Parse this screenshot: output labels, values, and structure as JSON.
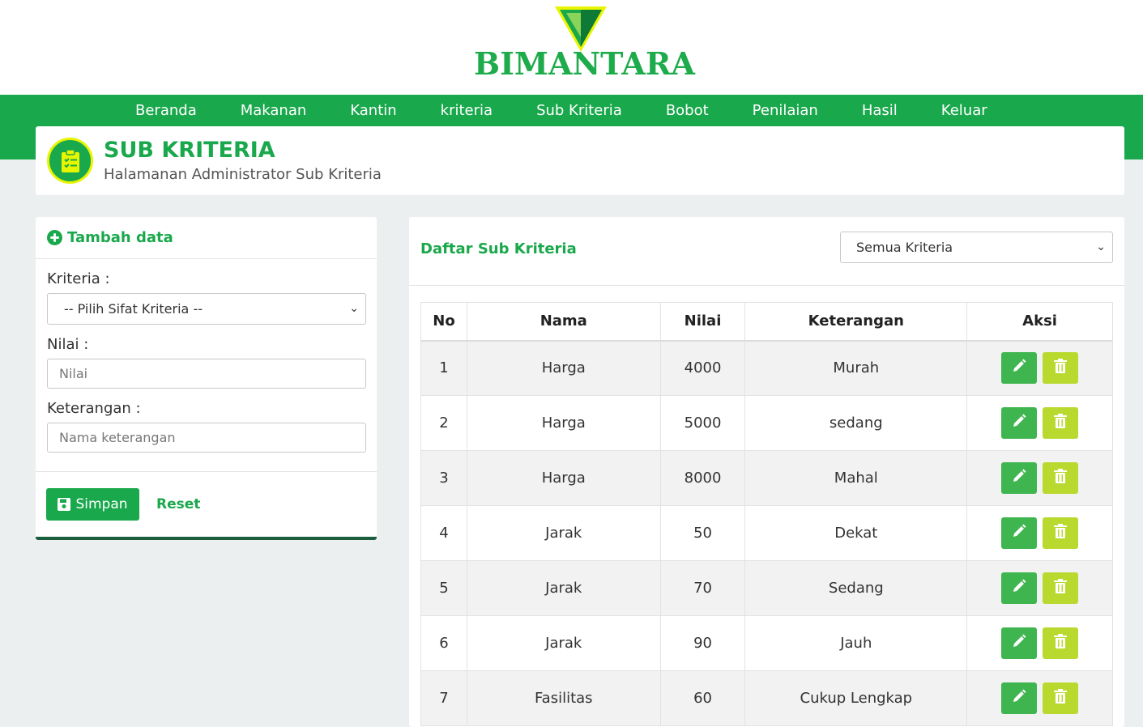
{
  "brand": {
    "name": "BIMANTARA",
    "colors": {
      "primary": "#1aa84c",
      "accent": "#e8f500",
      "delete": "#b9d92f",
      "edit": "#3fb54f"
    }
  },
  "nav": {
    "items": [
      {
        "label": "Beranda"
      },
      {
        "label": "Makanan"
      },
      {
        "label": "Kantin"
      },
      {
        "label": "kriteria"
      },
      {
        "label": "Sub Kriteria"
      },
      {
        "label": "Bobot"
      },
      {
        "label": "Penilaian"
      },
      {
        "label": "Hasil"
      },
      {
        "label": "Keluar"
      }
    ]
  },
  "page": {
    "icon": "clipboard-icon",
    "title": "SUB KRITERIA",
    "subtitle": "Halamanan Administrator Sub Kriteria"
  },
  "form": {
    "title": "Tambah data",
    "title_icon": "plus-circle-icon",
    "kriteria_label": "Kriteria :",
    "kriteria_selected": "-- Pilih Sifat Kriteria --",
    "nilai_label": "Nilai :",
    "nilai_placeholder": "Nilai",
    "keterangan_label": "Keterangan :",
    "keterangan_placeholder": "Nama keterangan",
    "save_label": "Simpan",
    "save_icon": "floppy-icon",
    "reset_label": "Reset"
  },
  "list": {
    "title": "Daftar Sub Kriteria",
    "filter_selected": "Semua Kriteria",
    "columns": [
      "No",
      "Nama",
      "Nilai",
      "Keterangan",
      "Aksi"
    ],
    "rows": [
      {
        "no": "1",
        "nama": "Harga",
        "nilai": "4000",
        "keterangan": "Murah"
      },
      {
        "no": "2",
        "nama": "Harga",
        "nilai": "5000",
        "keterangan": "sedang"
      },
      {
        "no": "3",
        "nama": "Harga",
        "nilai": "8000",
        "keterangan": "Mahal"
      },
      {
        "no": "4",
        "nama": "Jarak",
        "nilai": "50",
        "keterangan": "Dekat"
      },
      {
        "no": "5",
        "nama": "Jarak",
        "nilai": "70",
        "keterangan": "Sedang"
      },
      {
        "no": "6",
        "nama": "Jarak",
        "nilai": "90",
        "keterangan": "Jauh"
      },
      {
        "no": "7",
        "nama": "Fasilitas",
        "nilai": "60",
        "keterangan": "Cukup Lengkap"
      }
    ],
    "action_icons": {
      "edit": "pencil-icon",
      "delete": "trash-icon"
    }
  }
}
